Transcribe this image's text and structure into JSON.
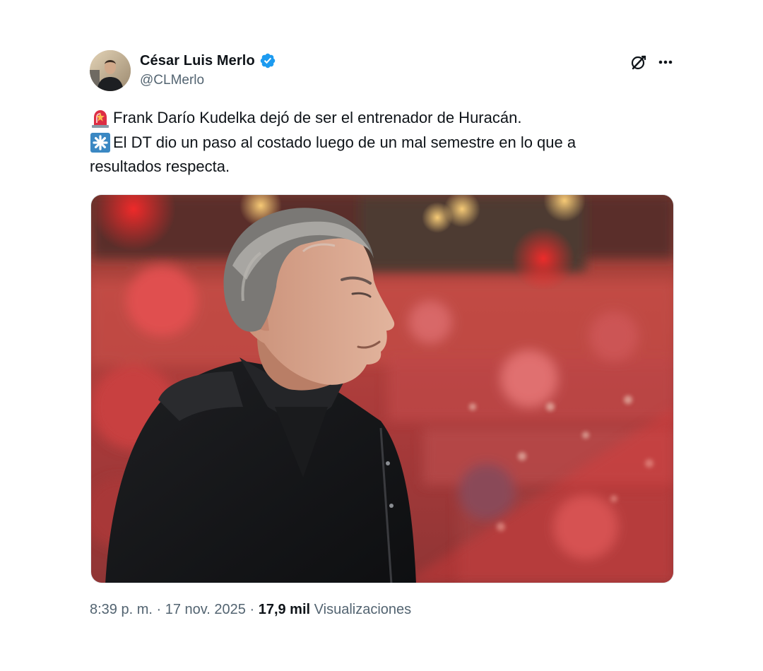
{
  "author": {
    "display_name": "César Luis Merlo",
    "handle": "@CLMerlo",
    "verified_badge_color": "#1d9bf0"
  },
  "header_icons": {
    "grok": "grok-icon",
    "more": "more-icon"
  },
  "tweet": {
    "lines": [
      {
        "emoji": "rotating-light-icon",
        "text": "Frank Darío Kudelka dejó de ser el entrenador de Huracán."
      },
      {
        "emoji": "eight-spoked-asterisk-icon",
        "text": "El DT dio un paso al costado luego de un mal semestre en lo que a"
      },
      {
        "emoji": "",
        "text": "resultados respecta."
      }
    ]
  },
  "media": {
    "subject": "photo-man-gray-hair-black-jacket-stadium-red-crowd"
  },
  "meta": {
    "time": "8:39 p. m.",
    "separator": "·",
    "date": "17 nov. 2025",
    "views_count": "17,9 mil",
    "views_label": "Visualizaciones"
  },
  "colors": {
    "text_primary": "#0f1419",
    "text_secondary": "#536471",
    "verified": "#1d9bf0"
  }
}
